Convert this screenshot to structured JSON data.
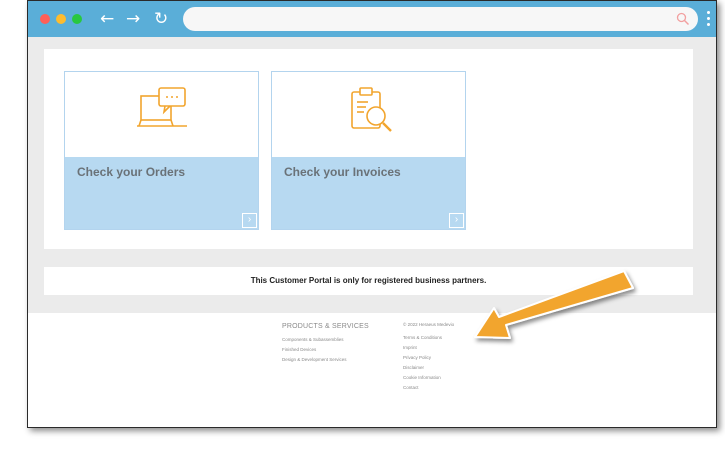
{
  "browser": {
    "traffic_lights": [
      "#ff5f57",
      "#febc2e",
      "#28c840"
    ],
    "nav": {
      "back": "←",
      "forward": "→",
      "reload": "↻"
    },
    "url_value": "",
    "chrome_color": "#5aaed8"
  },
  "tiles": [
    {
      "label": "Check your Orders",
      "icon": "laptop-chat-icon",
      "arrow": "›"
    },
    {
      "label": "Check your Invoices",
      "icon": "clipboard-search-icon",
      "arrow": "›"
    }
  ],
  "notice": "This Customer Portal is only for registered business partners.",
  "footer": {
    "products_heading": "PRODUCTS & SERVICES",
    "products": [
      "Components & Subassemblies",
      "Finished Devices",
      "Design & Development Services"
    ],
    "copyright": "© 2022 Heraeus Medevio",
    "links": [
      "Terms & Conditions",
      "Imprint",
      "Privacy Policy",
      "Disclaimer",
      "Cookie Information",
      "Contact"
    ]
  },
  "colors": {
    "accent_orange": "#f2a52e",
    "tile_blue": "#b7d9f1"
  }
}
